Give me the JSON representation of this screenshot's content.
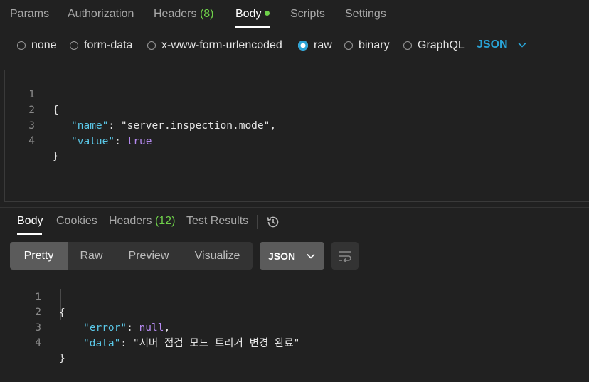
{
  "request_tabs": [
    {
      "label": "Params"
    },
    {
      "label": "Authorization"
    },
    {
      "label": "Headers",
      "count": "(8)"
    },
    {
      "label": "Body"
    },
    {
      "label": "Scripts"
    },
    {
      "label": "Settings"
    }
  ],
  "body_types": [
    "none",
    "form-data",
    "x-www-form-urlencoded",
    "raw",
    "binary",
    "GraphQL"
  ],
  "body_type_selected": "raw",
  "language": "JSON",
  "request_code": {
    "line_numbers": [
      "1",
      "2",
      "3",
      "4"
    ],
    "open_brace": "{",
    "close_brace": "}",
    "key1": "\"name\"",
    "value1": "\"server.inspection.mode\"",
    "key2": "\"value\"",
    "value2": "true"
  },
  "response_tabs": [
    {
      "label": "Body"
    },
    {
      "label": "Cookies"
    },
    {
      "label": "Headers",
      "count": "(12)"
    },
    {
      "label": "Test Results"
    }
  ],
  "view_modes": [
    "Pretty",
    "Raw",
    "Preview",
    "Visualize"
  ],
  "response_format": "JSON",
  "response_code": {
    "line_numbers": [
      "1",
      "2",
      "3",
      "4"
    ],
    "open_brace": "{",
    "close_brace": "}",
    "key1": "\"error\"",
    "value1": "null",
    "key2": "\"data\"",
    "value2": "\"서버 점검 모드 트리거 변경 완료\""
  },
  "colors": {
    "accent_green": "#6fd14a",
    "accent_blue": "#29a3d6",
    "json_key": "#5bc8e8",
    "json_keyword": "#b58af0"
  }
}
